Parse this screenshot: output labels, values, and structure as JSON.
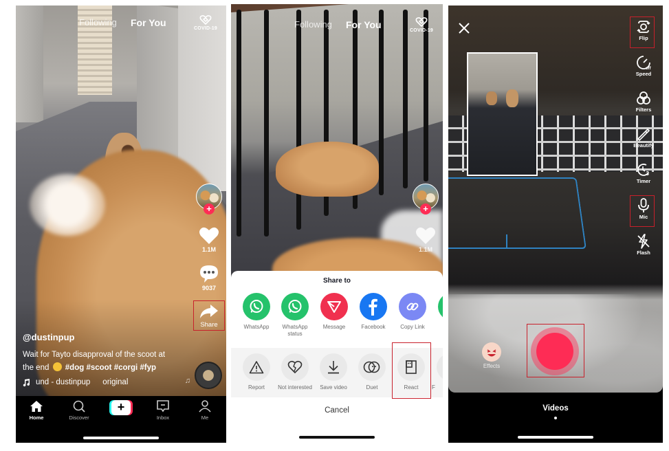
{
  "feed": {
    "tabs": {
      "following": "Following",
      "for_you": "For You"
    },
    "covid_label": "COVID-19",
    "actions": {
      "likes": "1.1M",
      "comments": "9037",
      "share": "Share"
    },
    "caption": {
      "username": "@dustinpup",
      "text_line1": "Wait for Tayto disapproval of the scoot at",
      "text_line2": "the end",
      "hashtags": "#dog #scoot #corgi #fyp",
      "sound_name": "und - dustinpup",
      "sound_suffix": "original"
    },
    "tabbar": [
      {
        "label": "Home",
        "icon": "home-icon",
        "active": true
      },
      {
        "label": "Discover",
        "icon": "search-icon"
      },
      {
        "label": "",
        "icon": "create-plus-icon"
      },
      {
        "label": "Inbox",
        "icon": "inbox-icon"
      },
      {
        "label": "Me",
        "icon": "profile-icon"
      }
    ]
  },
  "share_sheet": {
    "feed_likes": "1.1M",
    "title": "Share to",
    "targets": [
      {
        "label": "WhatsApp",
        "icon": "whatsapp-icon",
        "color": "#25d366"
      },
      {
        "label": "WhatsApp status",
        "icon": "whatsapp-icon",
        "color": "#25d366"
      },
      {
        "label": "Message",
        "icon": "message-send-icon",
        "color": "#fe2c55"
      },
      {
        "label": "Facebook",
        "icon": "facebook-icon",
        "color": "#1877f2"
      },
      {
        "label": "Copy Link",
        "icon": "link-icon",
        "color": "#7b88f4"
      }
    ],
    "actions": [
      {
        "label": "Report",
        "icon": "warning-icon"
      },
      {
        "label": "Not interested",
        "icon": "broken-heart-icon"
      },
      {
        "label": "Save video",
        "icon": "download-icon"
      },
      {
        "label": "Duet",
        "icon": "duet-icon"
      },
      {
        "label": "React",
        "icon": "react-icon"
      },
      {
        "label": "F",
        "icon": "favorite-icon"
      }
    ],
    "cancel": "Cancel"
  },
  "camera": {
    "tools": [
      {
        "label": "Flip",
        "icon": "flip-camera-icon",
        "highlighted": true
      },
      {
        "label": "Speed",
        "icon": "speed-icon"
      },
      {
        "label": "Filters",
        "icon": "filters-icon"
      },
      {
        "label": "Beautify",
        "icon": "beautify-icon"
      },
      {
        "label": "Timer",
        "icon": "timer-icon"
      },
      {
        "label": "Mic",
        "icon": "mic-icon",
        "highlighted": true
      },
      {
        "label": "Flash",
        "icon": "flash-off-icon"
      }
    ],
    "effects_label": "Effects",
    "mode_label": "Videos"
  },
  "colors": {
    "accent": "#fe2c55",
    "highlight_box": "#c8202b",
    "teal": "#25f4ee"
  }
}
